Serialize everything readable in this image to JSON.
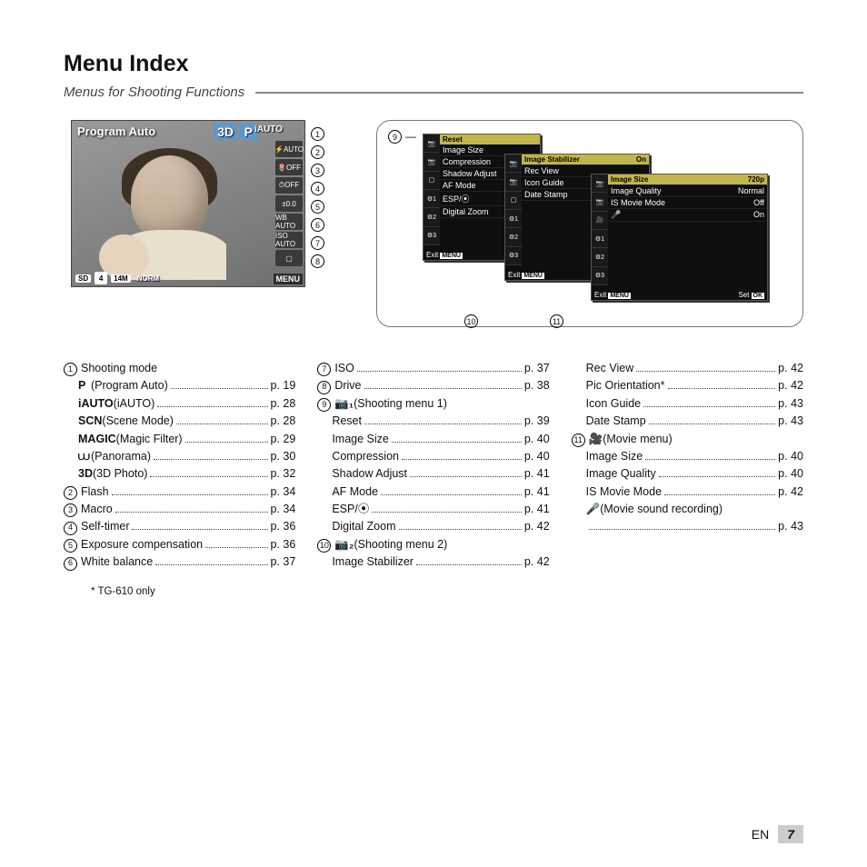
{
  "page": {
    "title": "Menu Index",
    "subtitle": "Menus for Shooting Functions",
    "lang": "EN",
    "number": "7",
    "footnote": "* TG-610 only"
  },
  "lcd": {
    "title": "Program Auto",
    "tag3d": "3D",
    "tagP": "P",
    "tagIA": "iAUTO",
    "menucorner": "MENU",
    "side": [
      "⚡AUTO",
      "🌷OFF",
      "⏱OFF",
      "±0.0",
      "WB AUTO",
      "ISO AUTO",
      "▢"
    ],
    "bottom": {
      "sd": "SD",
      "n": "4",
      "mp": "14M",
      "norm": "NORM"
    }
  },
  "leftCallouts": [
    "1",
    "2",
    "3",
    "4",
    "5",
    "6",
    "7",
    "8"
  ],
  "screens": {
    "s1": {
      "hrow": "Reset",
      "rows": [
        "Image Size",
        "Compression",
        "Shadow Adjust",
        "AF Mode",
        "ESP/⦿",
        "Digital Zoom"
      ],
      "exit": "Exit",
      "menu": "MENU",
      "sideIcons": [
        "📷",
        "📷",
        "▢",
        "⚙1",
        "⚙2",
        "⚙3"
      ]
    },
    "s2": {
      "rows": [
        [
          "Image Stabilizer",
          "On"
        ],
        [
          "Rec View",
          ""
        ],
        [
          "Icon Guide",
          ""
        ],
        [
          "Date Stamp",
          ""
        ]
      ],
      "exit": "Exit",
      "menu": "MENU",
      "sideIcons": [
        "📷",
        "📷",
        "▢",
        "⚙1",
        "⚙2",
        "⚙3"
      ]
    },
    "s3": {
      "rows": [
        [
          "Image Size",
          "720p"
        ],
        [
          "Image Quality",
          "Normal"
        ],
        [
          "IS Movie Mode",
          "Off"
        ],
        [
          "🎤",
          "On"
        ]
      ],
      "exit": "Exit",
      "menu": "MENU",
      "set": "Set",
      "ok": "OK",
      "sideIcons": [
        "📷",
        "📷",
        "🎥",
        "⚙1",
        "⚙2",
        "⚙3"
      ]
    },
    "labels": {
      "n9": "9",
      "n10": "10",
      "n11": "11"
    }
  },
  "index": {
    "col1": [
      {
        "n": "1",
        "label": "Shooting mode",
        "header": true
      },
      {
        "sub": true,
        "pre": "P",
        "label": " (Program Auto)",
        "page": "p. 19"
      },
      {
        "sub": true,
        "pre": "iAUTO",
        "label": " (iAUTO)",
        "page": "p. 28"
      },
      {
        "sub": true,
        "pre": "SCN",
        "label": " (Scene Mode)",
        "page": "p. 28"
      },
      {
        "sub": true,
        "pre": "MAGIC",
        "label": " (Magic Filter)",
        "page": "p. 29"
      },
      {
        "sub": true,
        "pre": "⩊",
        "label": " (Panorama)",
        "page": "p. 30"
      },
      {
        "sub": true,
        "pre": "3D",
        "label": " (3D Photo)",
        "page": "p. 32"
      },
      {
        "n": "2",
        "label": "Flash",
        "page": "p. 34"
      },
      {
        "n": "3",
        "label": "Macro",
        "page": "p. 34"
      },
      {
        "n": "4",
        "label": "Self-timer",
        "page": "p. 36"
      },
      {
        "n": "5",
        "label": "Exposure compensation",
        "page": "p. 36"
      },
      {
        "n": "6",
        "label": "White balance",
        "page": "p. 37"
      }
    ],
    "col2": [
      {
        "n": "7",
        "label": "ISO",
        "page": "p. 37"
      },
      {
        "n": "8",
        "label": "Drive",
        "page": "p. 38"
      },
      {
        "n": "9",
        "pre": "📷₁",
        "label": " (Shooting menu 1)",
        "header": true
      },
      {
        "sub": true,
        "label": "Reset",
        "page": "p. 39"
      },
      {
        "sub": true,
        "label": "Image Size",
        "page": "p. 40"
      },
      {
        "sub": true,
        "label": "Compression",
        "page": "p. 40"
      },
      {
        "sub": true,
        "label": "Shadow Adjust",
        "page": "p. 41"
      },
      {
        "sub": true,
        "label": "AF Mode",
        "page": "p. 41"
      },
      {
        "sub": true,
        "label": "ESP/⦿",
        "page": "p. 41"
      },
      {
        "sub": true,
        "label": "Digital Zoom",
        "page": "p. 42"
      },
      {
        "n": "10",
        "pre": "📷₂",
        "label": " (Shooting menu 2)",
        "header": true
      },
      {
        "sub": true,
        "label": "Image Stabilizer",
        "page": "p. 42"
      }
    ],
    "col3": [
      {
        "sub": true,
        "label": "Rec View",
        "page": "p. 42"
      },
      {
        "sub": true,
        "label": "Pic Orientation*",
        "page": "p. 42"
      },
      {
        "sub": true,
        "label": "Icon Guide",
        "page": "p. 43"
      },
      {
        "sub": true,
        "label": "Date Stamp",
        "page": "p. 43"
      },
      {
        "n": "11",
        "pre": "🎥",
        "label": " (Movie menu)",
        "header": true
      },
      {
        "sub": true,
        "label": "Image Size",
        "page": "p. 40"
      },
      {
        "sub": true,
        "label": "Image Quality",
        "page": "p. 40"
      },
      {
        "sub": true,
        "label": "IS Movie Mode",
        "page": "p. 42"
      },
      {
        "sub": true,
        "pre": "🎤",
        "label": " (Movie sound recording)",
        "header": true
      },
      {
        "sub": true,
        "label": "",
        "page": "p. 43"
      }
    ]
  }
}
